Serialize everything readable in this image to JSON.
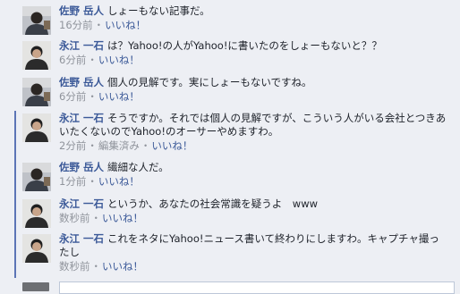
{
  "comments": [
    {
      "author": "佐野 岳人",
      "text": "しょーもない記事だ。",
      "time": "16分前",
      "sep": "・",
      "like": "いいね！"
    },
    {
      "author": "永江 一石",
      "text": "は？Yahoo!の人がYahoo!に書いたのをしょーもないと？？",
      "time": "6分前",
      "sep": "・",
      "like": "いいね！"
    },
    {
      "author": "佐野 岳人",
      "text": "個人の見解です。実にしょーもないですね。",
      "time": "6分前",
      "sep": "・",
      "like": "いいね！"
    },
    {
      "author": "永江 一石",
      "text": "そうですか。それでは個人の見解ですが、こういう人がいる会社とつきあいたくないのでYahoo!のオーサーやめますわ。",
      "time": "2分前",
      "sep": "・",
      "edited": "編集済み",
      "sep2": "・",
      "like": "いいね！"
    },
    {
      "author": "佐野 岳人",
      "text": "繊細な人だ。",
      "time": "1分前",
      "sep": "・",
      "like": "いいね！"
    },
    {
      "author": "永江 一石",
      "text": "というか、あなたの社会常識を疑うよ　www",
      "time": "数秒前",
      "sep": "・",
      "like": "いいね！"
    },
    {
      "author": "永江 一石",
      "text": "これをネタにYahoo!ニュース書いて終わりにしますわ。キャプチャ撮ったし",
      "time": "数秒前",
      "sep": "・",
      "like": "いいね！"
    }
  ],
  "colors": {
    "link": "#3b5998",
    "meta": "#90949c",
    "background": "#edeff4",
    "marker": "#5c75b6"
  }
}
